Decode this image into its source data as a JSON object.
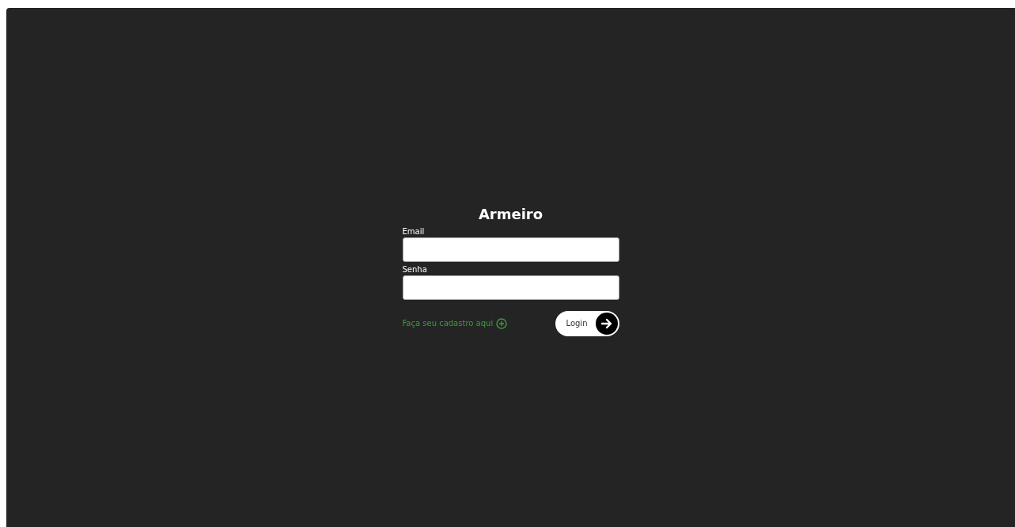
{
  "title": "Armeiro",
  "fields": [
    {
      "label": "Email"
    },
    {
      "label": "Senha"
    }
  ],
  "signup_link": "Faça seu cadastro aqui",
  "login_button": "Login"
}
